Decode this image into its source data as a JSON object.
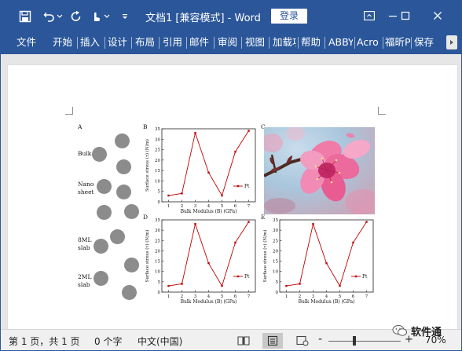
{
  "titlebar": {
    "document_title": "文档1 [兼容模式]  -  Word",
    "login_label": "登录",
    "icons": [
      "save-icon",
      "undo-icon",
      "redo-icon",
      "touch-mode-icon",
      "customize-qat-icon",
      "ribbon-display-options-icon",
      "minimize-icon",
      "maximize-icon",
      "close-icon"
    ]
  },
  "ribbon": {
    "tabs": [
      "文件",
      "开始",
      "插入",
      "设计",
      "布局",
      "引用",
      "邮件",
      "审阅",
      "视图",
      "加载项",
      "帮助",
      "ABBYY",
      "Acro",
      "福昕PDF",
      "保存"
    ]
  },
  "figure": {
    "panel_letters": [
      "A",
      "B",
      "C",
      "D",
      "E"
    ],
    "layer_labels": {
      "bulk": "Bulk",
      "nano1": "Nano",
      "nano2": "sheet",
      "ml8a": "8ML",
      "ml8b": "slab",
      "ml2a": "2ML",
      "ml2b": "slab"
    }
  },
  "chart_data": [
    {
      "panel": "B",
      "type": "line",
      "xlabel": "Bulk Modulus (B) (GPa)",
      "ylabel": "Surface stress (τ) (N/m)",
      "x": [
        1,
        2,
        3,
        4,
        5,
        6,
        7
      ],
      "y": [
        3,
        4,
        33,
        14,
        3,
        24,
        34
      ],
      "xlim": [
        0.5,
        7.5
      ],
      "ylim": [
        0,
        35
      ],
      "yticks": [
        0,
        5,
        10,
        15,
        20,
        25,
        30,
        35
      ],
      "xticks": [
        1,
        2,
        3,
        4,
        5,
        6,
        7
      ],
      "legend": "Pt",
      "color": "#c00000"
    },
    {
      "panel": "D",
      "type": "line",
      "xlabel": "Bulk Modulus (B) (GPa)",
      "ylabel": "Surface stress (τ) (N/m)",
      "x": [
        1,
        2,
        3,
        4,
        5,
        6,
        7
      ],
      "y": [
        3,
        4,
        33,
        14,
        3,
        24,
        34
      ],
      "xlim": [
        0.5,
        7.5
      ],
      "ylim": [
        0,
        35
      ],
      "yticks": [
        0,
        5,
        10,
        15,
        20,
        25,
        30,
        35
      ],
      "xticks": [
        1,
        2,
        3,
        4,
        5,
        6,
        7
      ],
      "legend": "Pt",
      "color": "#c00000"
    },
    {
      "panel": "E",
      "type": "line",
      "xlabel": "Bulk Modulus (B) (GPa)",
      "ylabel": "Surface stress (τ) (N/m)",
      "x": [
        1,
        2,
        3,
        4,
        5,
        6,
        7
      ],
      "y": [
        3,
        4,
        33,
        14,
        3,
        24,
        34
      ],
      "xlim": [
        0.5,
        7.5
      ],
      "ylim": [
        0,
        35
      ],
      "yticks": [
        0,
        5,
        10,
        15,
        20,
        25,
        30,
        35
      ],
      "xticks": [
        1,
        2,
        3,
        4,
        5,
        6,
        7
      ],
      "legend": "Pt",
      "color": "#c00000"
    }
  ],
  "statusbar": {
    "page_info": "第 1 页，共 1 页",
    "word_count": "0 个字",
    "language": "中文(中国)",
    "zoom_minus": "-",
    "zoom_plus": "+",
    "zoom_level": "70%",
    "watermark": "软件通"
  },
  "colors": {
    "brand": "#2b579a",
    "series": "#c00000",
    "circle": "#8c8c8c"
  }
}
